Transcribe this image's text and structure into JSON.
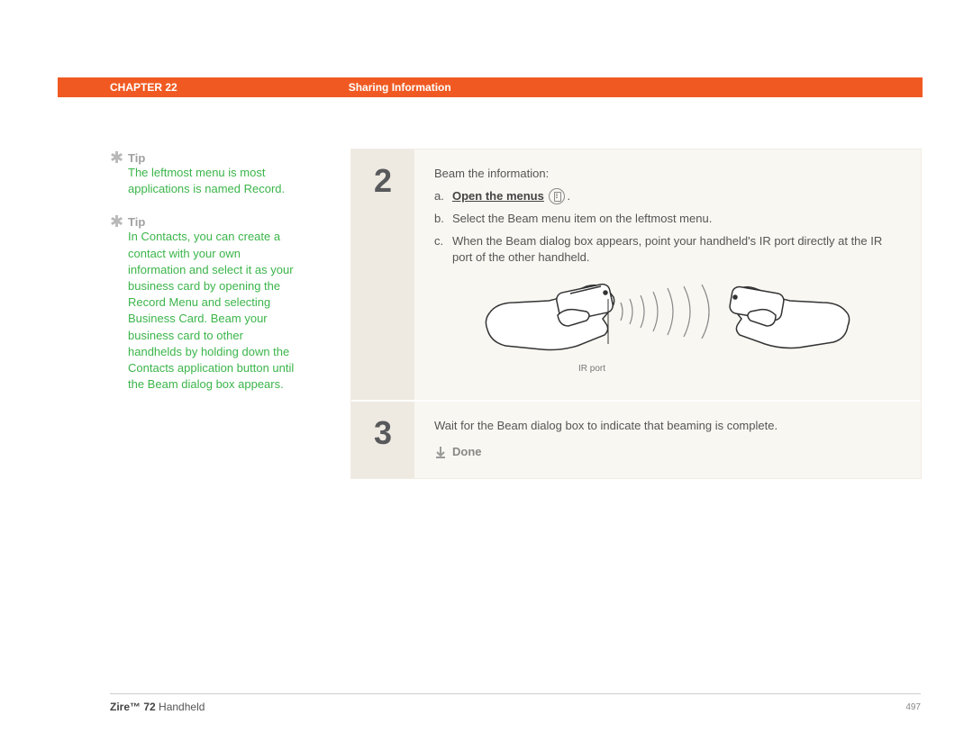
{
  "header": {
    "chapter": "CHAPTER 22",
    "section": "Sharing Information"
  },
  "tips": [
    {
      "heading": "Tip",
      "body": "The leftmost menu is most applications is named Record."
    },
    {
      "heading": "Tip",
      "body": "In Contacts, you can create a contact with your own information and select it as your business card by opening the Record Menu and selecting Business Card. Beam your business card to other handhelds by holding down the Contacts application button until the Beam dialog box appears."
    }
  ],
  "steps": {
    "s2": {
      "num": "2",
      "intro": "Beam the information:",
      "a_letter": "a.",
      "a_text": "Open the menus",
      "a_after": ".",
      "b_letter": "b.",
      "b_text": "Select the Beam menu item on the leftmost menu.",
      "c_letter": "c.",
      "c_text": "When the Beam dialog box appears, point your handheld's IR port directly at the IR port of the other handheld.",
      "ir_label": "IR port"
    },
    "s3": {
      "num": "3",
      "text": "Wait for the Beam dialog box to indicate that beaming is complete.",
      "done": "Done"
    }
  },
  "footer": {
    "product_bold": "Zire™ 72",
    "product_rest": " Handheld",
    "page": "497"
  }
}
